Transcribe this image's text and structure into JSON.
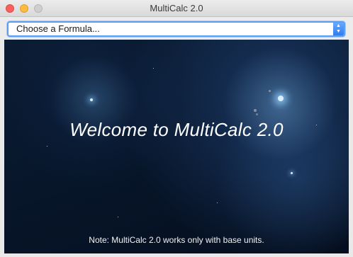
{
  "window": {
    "title": "MultiCalc 2.0"
  },
  "formula_select": {
    "selected": "Choose a Formula...",
    "arrows": "▲▼"
  },
  "content": {
    "welcome": "Welcome to MultiCalc 2.0",
    "note": "Note: MultiCalc 2.0 works only with base units."
  },
  "colors": {
    "close": "#fc605c",
    "minimize": "#fdbc40",
    "zoom": "#cfcfcf",
    "select_focus": "#5b9ef6",
    "background": "#08172c"
  }
}
